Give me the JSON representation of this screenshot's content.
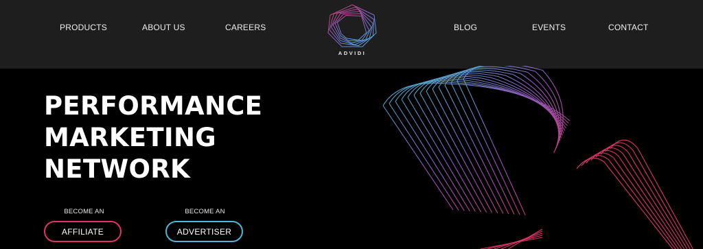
{
  "nav": {
    "left": [
      "PRODUCTS",
      "ABOUT US",
      "CAREERS"
    ],
    "right": [
      "BLOG",
      "EVENTS",
      "CONTACT"
    ]
  },
  "logo": {
    "text": "ADVIDI"
  },
  "hero": {
    "headline": [
      "PERFORMANCE",
      "MARKETING",
      "NETWORK"
    ]
  },
  "cta": [
    {
      "caption": "BECOME AN",
      "label": "AFFILIATE",
      "color": "#e0336a"
    },
    {
      "caption": "BECOME AN",
      "label": "ADVERTISER",
      "color": "#4fb6d8"
    }
  ],
  "colors": {
    "accent_pink": "#e0336a",
    "accent_blue": "#4fb6d8",
    "header_bg": "#1e1e1e"
  }
}
